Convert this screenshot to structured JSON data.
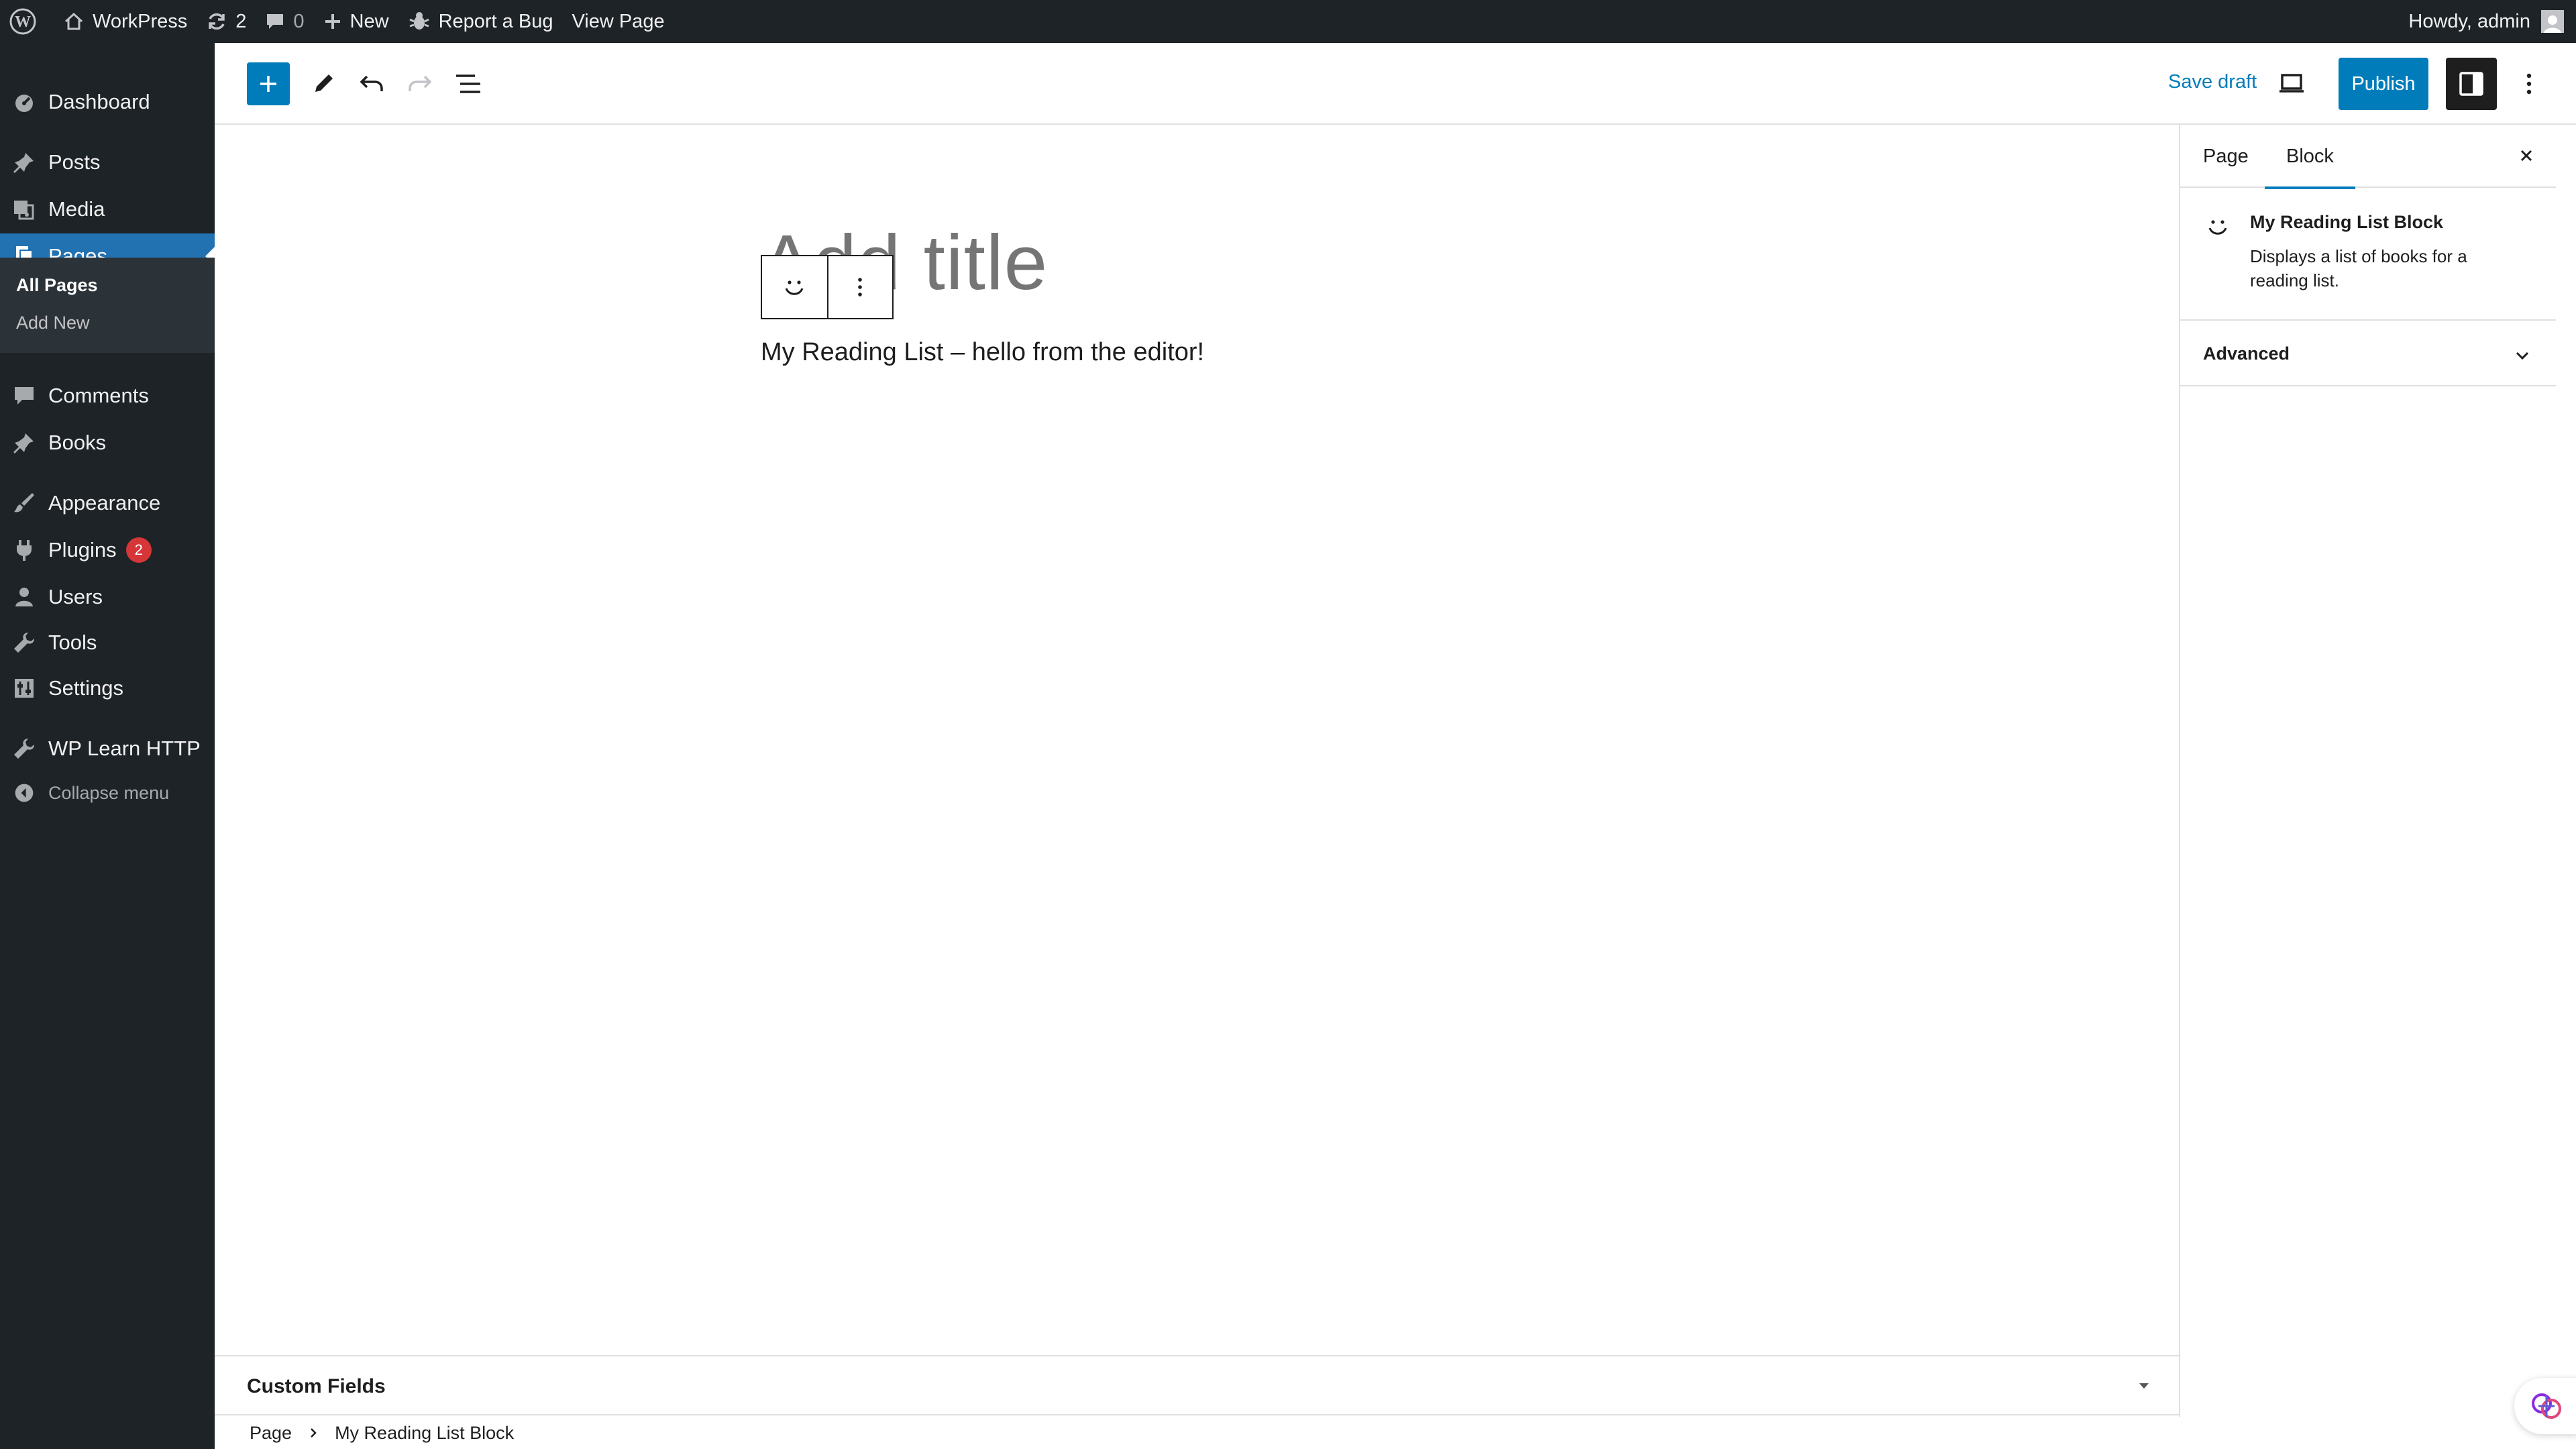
{
  "admin_bar": {
    "site_name": "WorkPress",
    "updates_count": "2",
    "comments_count": "0",
    "new_label": "New",
    "report_bug_label": "Report a Bug",
    "view_page_label": "View Page",
    "howdy_label": "Howdy, admin"
  },
  "admin_menu": {
    "items": [
      {
        "label": "Dashboard",
        "icon": "dashboard-icon"
      },
      {
        "label": "Posts",
        "icon": "pin-icon"
      },
      {
        "label": "Media",
        "icon": "media-icon"
      },
      {
        "label": "Pages",
        "icon": "pages-icon"
      },
      {
        "label": "Comments",
        "icon": "comment-icon"
      },
      {
        "label": "Books",
        "icon": "pin-icon"
      },
      {
        "label": "Appearance",
        "icon": "brush-icon"
      },
      {
        "label": "Plugins",
        "icon": "plug-icon",
        "badge": "2"
      },
      {
        "label": "Users",
        "icon": "user-icon"
      },
      {
        "label": "Tools",
        "icon": "wrench-icon"
      },
      {
        "label": "Settings",
        "icon": "settings-icon"
      },
      {
        "label": "WP Learn HTTP",
        "icon": "wrench-icon"
      }
    ],
    "submenu": [
      "All Pages",
      "Add New"
    ],
    "collapse_label": "Collapse menu"
  },
  "toolbar": {
    "save_draft_label": "Save draft",
    "publish_label": "Publish"
  },
  "editor": {
    "title_placeholder": "Add title",
    "paragraph_text": "My Reading List – hello from the editor!"
  },
  "sidebar": {
    "tabs": [
      "Page",
      "Block"
    ],
    "active_tab": "Block",
    "block_card": {
      "title": "My Reading List Block",
      "description": "Displays a list of books for a reading list."
    },
    "advanced_label": "Advanced"
  },
  "custom_fields_label": "Custom Fields",
  "breadcrumbs": [
    "Page",
    "My Reading List Block"
  ],
  "colors": {
    "admin_dark": "#1d2327",
    "accent_blue": "#007cba",
    "menu_current": "#2271b1",
    "badge_red": "#d63638"
  }
}
